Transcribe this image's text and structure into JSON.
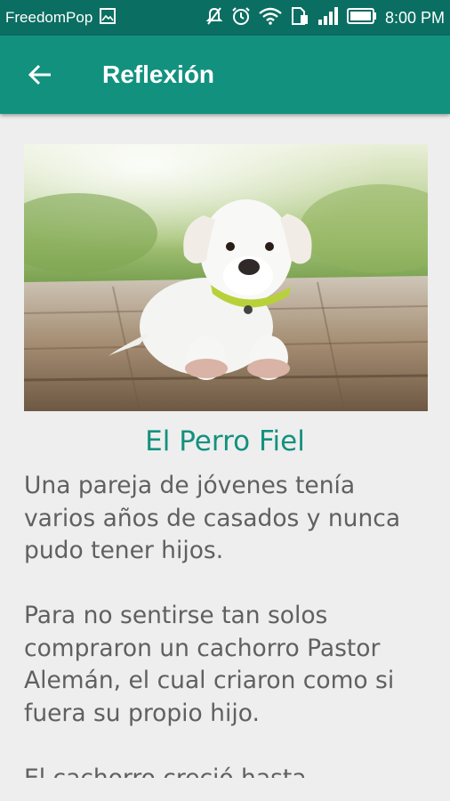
{
  "status_bar": {
    "carrier": "FreedomPop",
    "time": "8:00 PM",
    "icons": [
      "image-icon",
      "mute-icon",
      "alarm-icon",
      "wifi-icon",
      "sim-icon",
      "signal-icon",
      "battery-icon"
    ]
  },
  "app_bar": {
    "title": "Reflexión",
    "back_icon": "arrow-left-icon",
    "color": "#13917f"
  },
  "article": {
    "image": "white-puppy-photo",
    "title": "El Perro Fiel",
    "paragraphs": [
      "Una pareja de jóvenes tenía varios años de casados y nunca pudo tener hijos.",
      "Para no sentirse tan solos compraron un cachorro Pastor Alemán, el cual criaron como si fuera su propio hijo.",
      "El cachorro creció hasta"
    ]
  },
  "colors": {
    "accent": "#13917f",
    "status_bar": "#0b6e62",
    "body_text": "#606060",
    "background": "#eeeeee"
  }
}
